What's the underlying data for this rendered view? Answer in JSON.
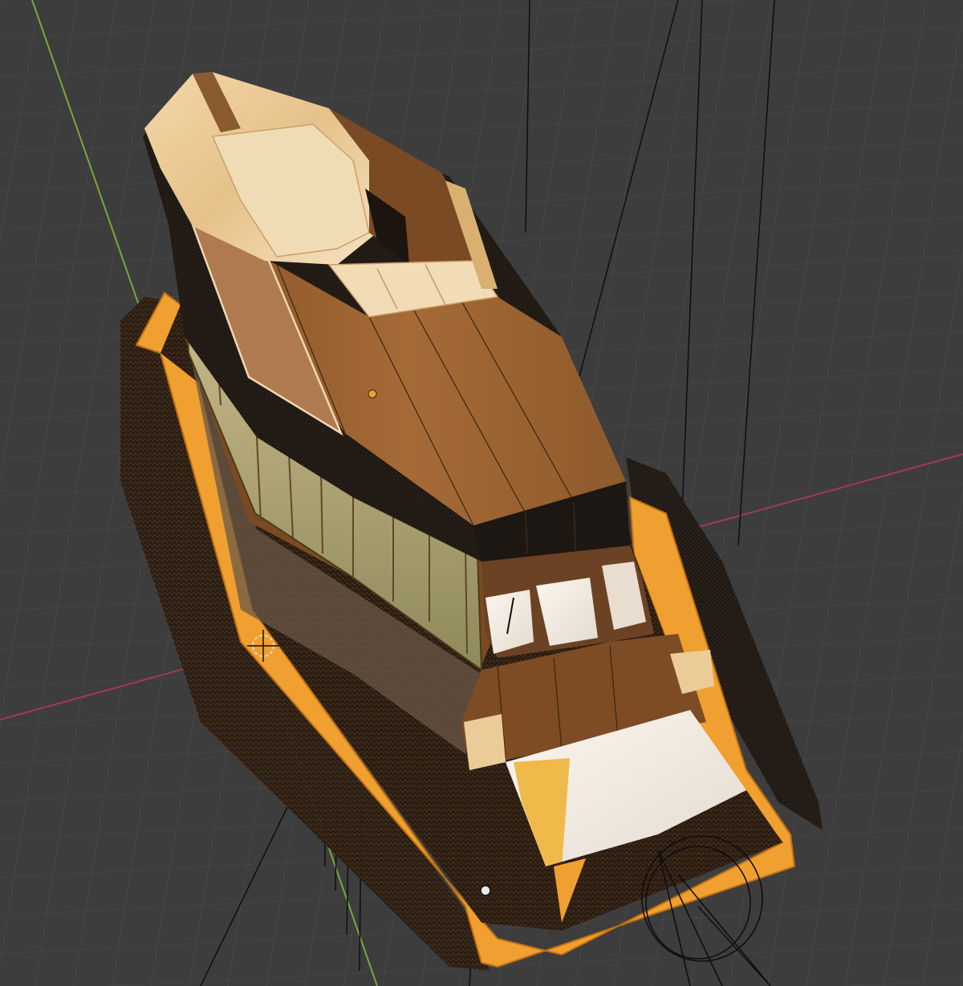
{
  "viewport": {
    "view": "perspective",
    "grid": true,
    "axes": {
      "x": "red",
      "y": "green"
    },
    "colors": {
      "background": "#3d3d3d",
      "grid_line": "#4a4a4a",
      "x_axis": "#a23a4e",
      "y_axis": "#7aa83a",
      "selection_outline": "#f0a030"
    }
  },
  "scene": {
    "object": "boat-model",
    "selected": true,
    "origin_marker": "orange-dot",
    "cursor": "3d-cursor",
    "camera_gizmo": "camera-circle"
  }
}
